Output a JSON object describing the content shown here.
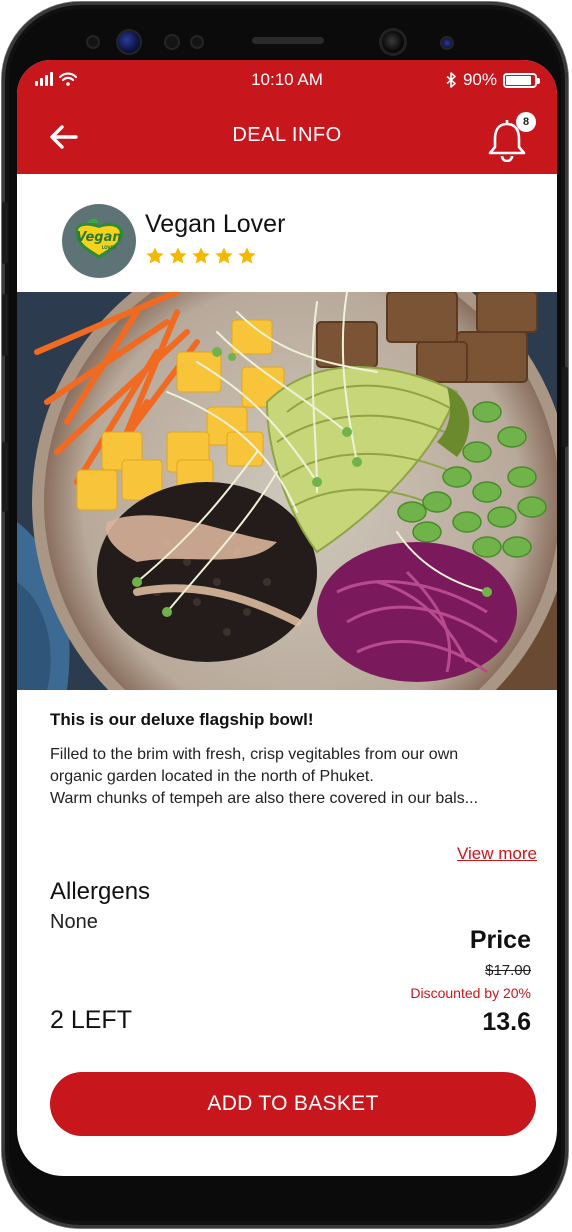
{
  "status_bar": {
    "time": "10:10 AM",
    "battery": "90%",
    "battery_level": 0.9
  },
  "header": {
    "title": "DEAL INFO",
    "back_icon": "arrow-left-icon",
    "notification_icon": "bell-icon",
    "notification_count": "8"
  },
  "vendor": {
    "name": "Vegan Lover",
    "logo_text": "Vegan",
    "logo_subtext": "LOVER",
    "rating": 5,
    "rating_max": 5
  },
  "deal": {
    "title": "This is our deluxe flagship bowl!",
    "description_lines": [
      "Filled to the brim with fresh, crisp vegitables from our own",
      "organic garden located in the north of Phuket.",
      "Warm chunks of tempeh are also there covered in our bals..."
    ],
    "view_more": "View more",
    "allergens_label": "Allergens",
    "allergens_value": "None",
    "price_label": "Price",
    "original_price": "$17.00",
    "discount_text": "Discounted by 20%",
    "final_price": "13.6",
    "stock_text": "2 LEFT",
    "add_button": "ADD TO BASKET"
  },
  "colors": {
    "brand_red": "#c8161d",
    "star_yellow": "#f5b800"
  }
}
